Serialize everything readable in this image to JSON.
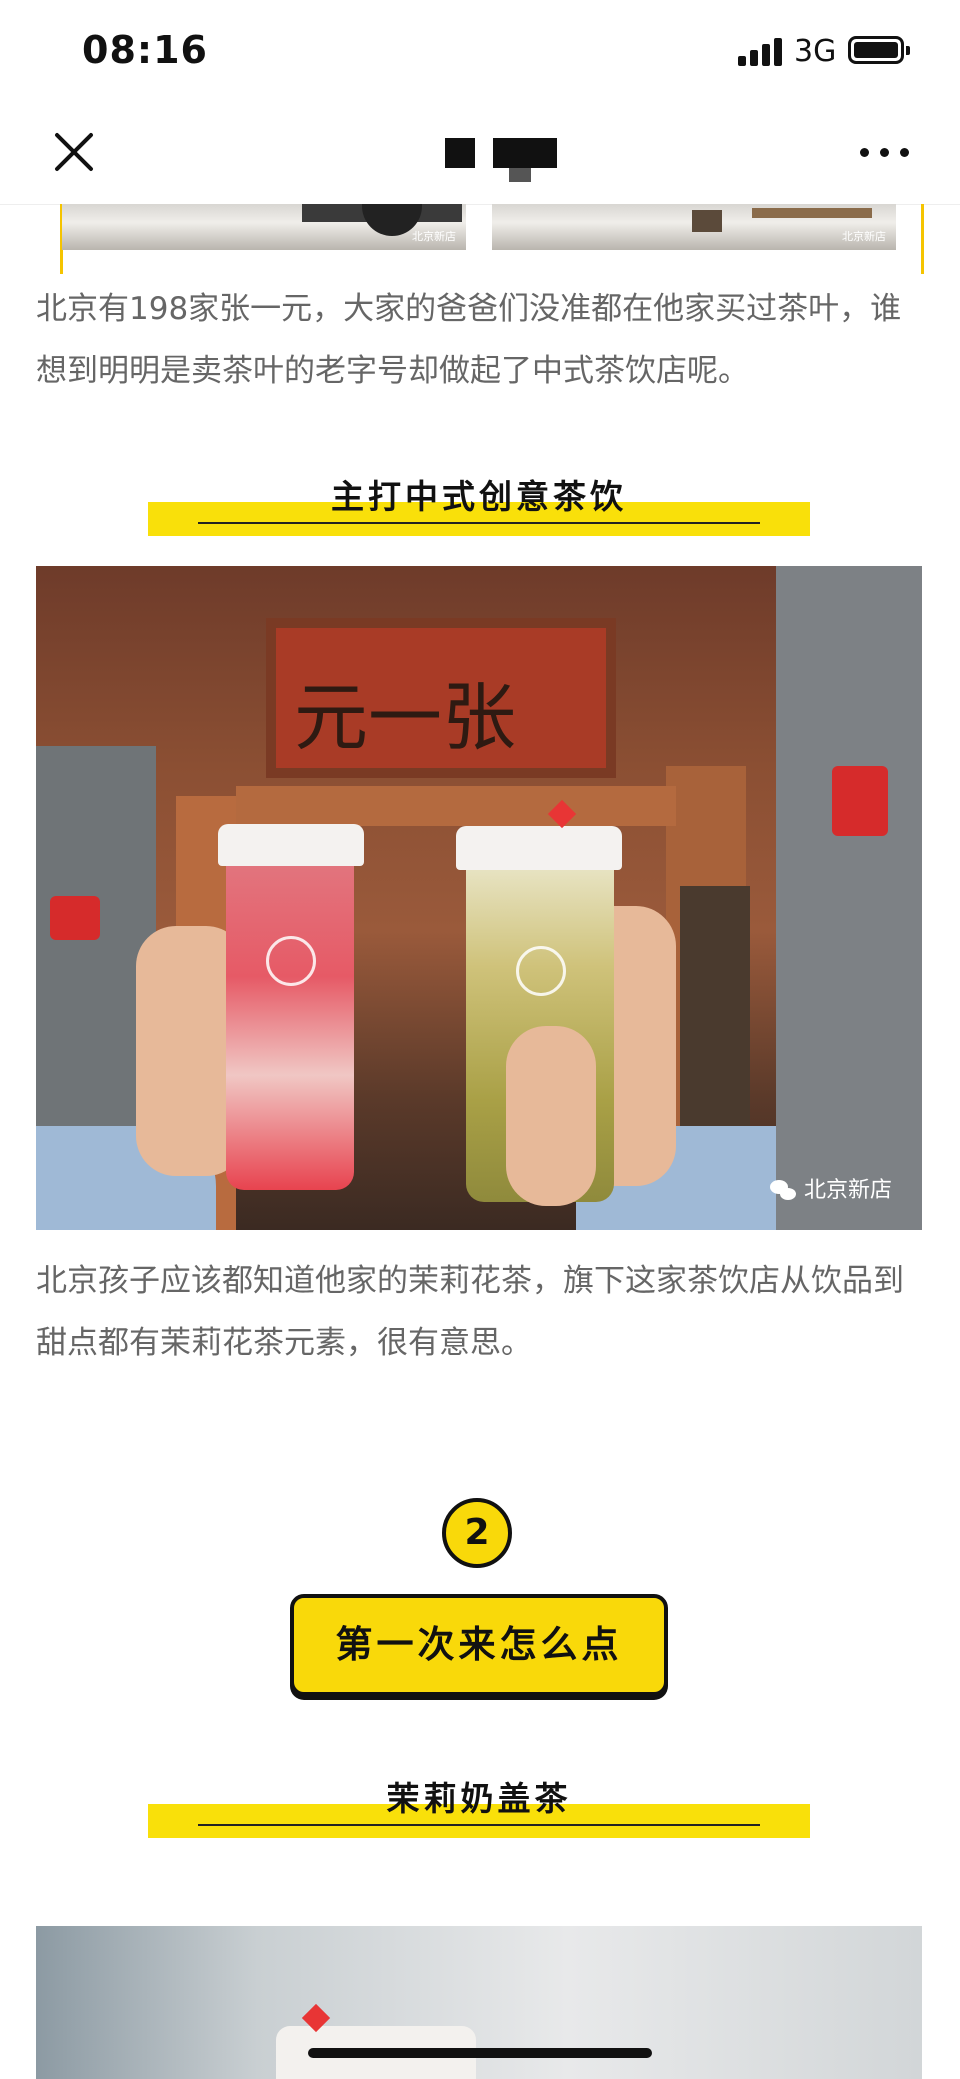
{
  "status_bar": {
    "time": "08:16",
    "network": "3G"
  },
  "navbar": {
    "close_icon": "close-icon",
    "more_icon": "more-icon",
    "title_obscured": true
  },
  "top_photos": {
    "watermark_left": "北京新店",
    "watermark_right": "北京新店"
  },
  "article": {
    "paragraph_1": "北京有198家张一元，大家的爸爸们没准都在他家买过茶叶，谁想到明明是卖茶叶的老字号却做起了中式茶饮店呢。",
    "heading_1": "主打中式创意茶饮",
    "photo_1": {
      "sign_text": "元一张",
      "watermark": "北京新店"
    },
    "paragraph_2": "北京孩子应该都知道他家的茉莉花茶，旗下这家茶饮店从饮品到甜点都有茉莉花茶元素，很有意思。",
    "step_number": "2",
    "cta_label": "第一次来怎么点",
    "heading_2": "茉莉奶盖茶"
  },
  "colors": {
    "accent_yellow": "#f9e00a",
    "text_gray": "#666666",
    "heading_black": "#111111"
  }
}
